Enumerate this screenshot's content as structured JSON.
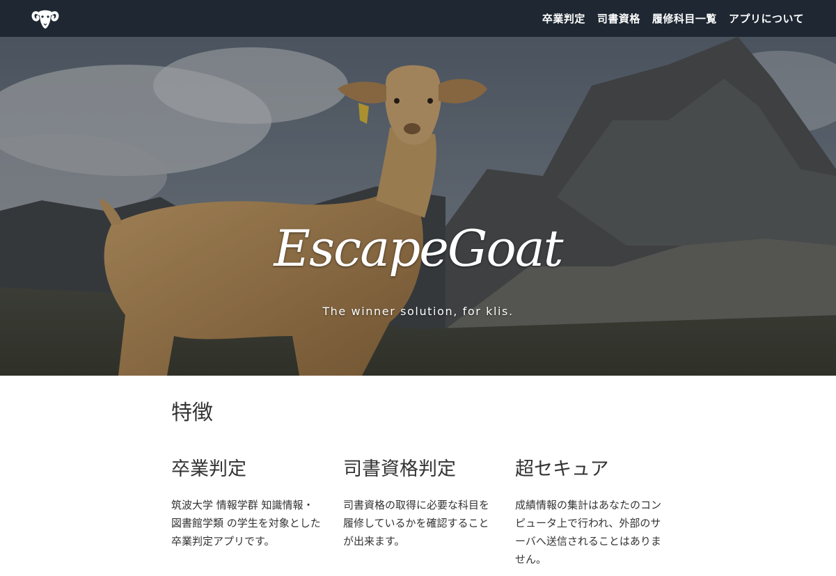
{
  "navbar": {
    "logo_icon": "ram-head-icon",
    "links": [
      "卒業判定",
      "司書資格",
      "履修科目一覧",
      "アプリについて"
    ]
  },
  "hero": {
    "title": "EscapeGoat",
    "subtitle": "The winner solution, for klis."
  },
  "features": {
    "heading": "特徴",
    "items": [
      {
        "title": "卒業判定",
        "text": "筑波大学 情報学群 知識情報・図書館学類 の学生を対象とした卒業判定アプリです。"
      },
      {
        "title": "司書資格判定",
        "text": "司書資格の取得に必要な科目を履修しているかを確認することが出来ます。"
      },
      {
        "title": "超セキュア",
        "text": "成績情報の集計はあなたのコンピュータ上で行われ、外部のサーバへ送信されることはありません。"
      }
    ]
  },
  "colors": {
    "navbar_bg": "#1e2732",
    "text": "#333333"
  }
}
